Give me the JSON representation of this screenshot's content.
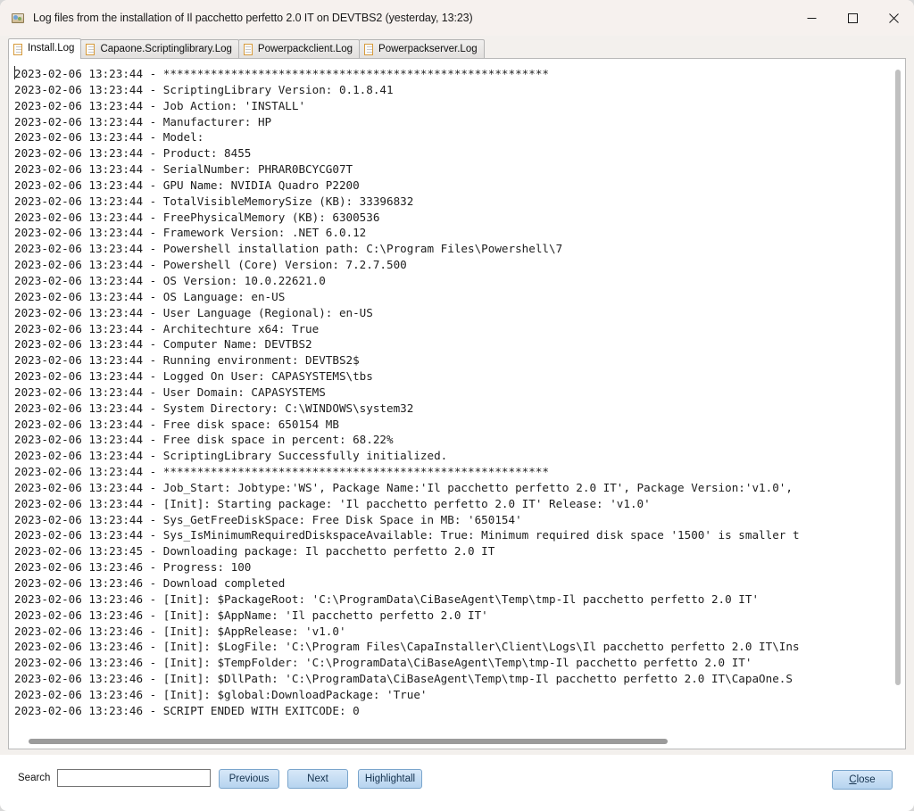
{
  "window": {
    "title": "Log files from the installation of Il pacchetto perfetto 2.0 IT on DEVTBS2 (yesterday, 13:23)",
    "icon": "log-viewer-icon",
    "controls": {
      "minimize": "minimize-icon",
      "maximize": "maximize-icon",
      "close": "close-icon"
    }
  },
  "tabs": [
    {
      "label": "Install.Log",
      "active": true
    },
    {
      "label": "Capaone.Scriptinglibrary.Log",
      "active": false
    },
    {
      "label": "Powerpackclient.Log",
      "active": false
    },
    {
      "label": "Powerpackserver.Log",
      "active": false
    }
  ],
  "log": {
    "lines": [
      "2023-02-06 13:23:44 - *********************************************************",
      "2023-02-06 13:23:44 - ScriptingLibrary Version: 0.1.8.41",
      "2023-02-06 13:23:44 - Job Action: 'INSTALL'",
      "2023-02-06 13:23:44 - Manufacturer: HP",
      "2023-02-06 13:23:44 - Model:",
      "2023-02-06 13:23:44 - Product: 8455",
      "2023-02-06 13:23:44 - SerialNumber: PHRAR0BCYCG07T",
      "2023-02-06 13:23:44 - GPU Name: NVIDIA Quadro P2200",
      "2023-02-06 13:23:44 - TotalVisibleMemorySize (KB): 33396832",
      "2023-02-06 13:23:44 - FreePhysicalMemory (KB): 6300536",
      "2023-02-06 13:23:44 - Framework Version: .NET 6.0.12",
      "2023-02-06 13:23:44 - Powershell installation path: C:\\Program Files\\Powershell\\7",
      "2023-02-06 13:23:44 - Powershell (Core) Version: 7.2.7.500",
      "2023-02-06 13:23:44 - OS Version: 10.0.22621.0",
      "2023-02-06 13:23:44 - OS Language: en-US",
      "2023-02-06 13:23:44 - User Language (Regional): en-US",
      "2023-02-06 13:23:44 - Architechture x64: True",
      "2023-02-06 13:23:44 - Computer Name: DEVTBS2",
      "2023-02-06 13:23:44 - Running environment: DEVTBS2$",
      "2023-02-06 13:23:44 - Logged On User: CAPASYSTEMS\\tbs",
      "2023-02-06 13:23:44 - User Domain: CAPASYSTEMS",
      "2023-02-06 13:23:44 - System Directory: C:\\WINDOWS\\system32",
      "2023-02-06 13:23:44 - Free disk space: 650154 MB",
      "2023-02-06 13:23:44 - Free disk space in percent: 68.22%",
      "2023-02-06 13:23:44 - ScriptingLibrary Successfully initialized.",
      "2023-02-06 13:23:44 - *********************************************************",
      "2023-02-06 13:23:44 - Job_Start: Jobtype:'WS', Package Name:'Il pacchetto perfetto 2.0 IT', Package Version:'v1.0', ",
      "2023-02-06 13:23:44 - [Init]: Starting package: 'Il pacchetto perfetto 2.0 IT' Release: 'v1.0'",
      "2023-02-06 13:23:44 - Sys_GetFreeDiskSpace: Free Disk Space in MB: '650154'",
      "2023-02-06 13:23:44 - Sys_IsMinimumRequiredDiskspaceAvailable: True: Minimum required disk space '1500' is smaller t",
      "2023-02-06 13:23:45 - Downloading package: Il pacchetto perfetto 2.0 IT",
      "2023-02-06 13:23:46 - Progress: 100",
      "2023-02-06 13:23:46 - Download completed",
      "2023-02-06 13:23:46 - [Init]: $PackageRoot: 'C:\\ProgramData\\CiBaseAgent\\Temp\\tmp-Il pacchetto perfetto 2.0 IT'",
      "2023-02-06 13:23:46 - [Init]: $AppName: 'Il pacchetto perfetto 2.0 IT'",
      "2023-02-06 13:23:46 - [Init]: $AppRelease: 'v1.0'",
      "2023-02-06 13:23:46 - [Init]: $LogFile: 'C:\\Program Files\\CapaInstaller\\Client\\Logs\\Il pacchetto perfetto 2.0 IT\\Ins",
      "2023-02-06 13:23:46 - [Init]: $TempFolder: 'C:\\ProgramData\\CiBaseAgent\\Temp\\tmp-Il pacchetto perfetto 2.0 IT'",
      "2023-02-06 13:23:46 - [Init]: $DllPath: 'C:\\ProgramData\\CiBaseAgent\\Temp\\tmp-Il pacchetto perfetto 2.0 IT\\CapaOne.S",
      "2023-02-06 13:23:46 - [Init]: $global:DownloadPackage: 'True'",
      "2023-02-06 13:23:46 - SCRIPT ENDED WITH EXITCODE: 0"
    ]
  },
  "footer": {
    "search_label": "Search",
    "search_value": "",
    "search_placeholder": "",
    "previous_label": "Previous",
    "next_label": "Next",
    "highlight_label": "Highlightall",
    "close_accel": "C",
    "close_rest": "lose"
  },
  "colors": {
    "titlebar_bg": "#f6f1ee",
    "button_blue": "#b6d4ef",
    "button_border": "#7aa5cc",
    "pane_bg": "#ffffff"
  }
}
